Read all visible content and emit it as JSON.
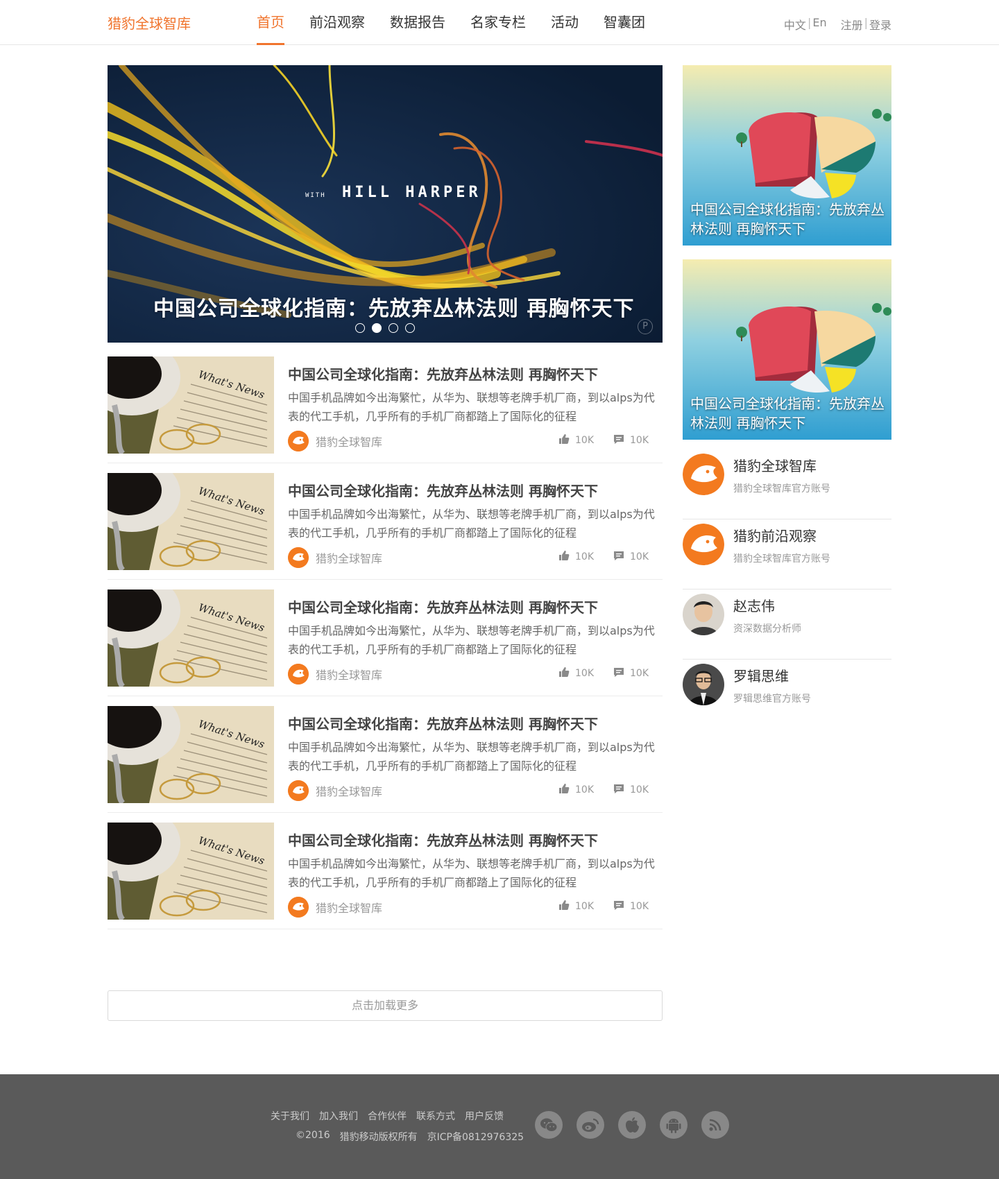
{
  "header": {
    "logo": "猎豹全球智库",
    "nav": [
      "首页",
      "前沿观察",
      "数据报告",
      "名家专栏",
      "活动",
      "智囊团"
    ],
    "active_nav": 0,
    "lang_zh": "中文",
    "lang_sep": "|",
    "lang_en": "En",
    "register": "注册",
    "auth_sep": "|",
    "login": "登录"
  },
  "hero": {
    "title": "中国公司全球化指南：先放弃丛林法则 再胸怀天下",
    "image_text": "HILL HARPER",
    "image_text_small": "WITH",
    "dots": 4,
    "active_dot": 1,
    "watermark": "P"
  },
  "articles": [
    {
      "title": "中国公司全球化指南：先放弃丛林法则 再胸怀天下",
      "desc": "中国手机品牌如今出海繁忙，从华为、联想等老牌手机厂商，到以alps为代表的代工手机，几乎所有的手机厂商都踏上了国际化的征程",
      "source": "猎豹全球智库",
      "likes": "10K",
      "comments": "10K"
    },
    {
      "title": "中国公司全球化指南：先放弃丛林法则 再胸怀天下",
      "desc": "中国手机品牌如今出海繁忙，从华为、联想等老牌手机厂商，到以alps为代表的代工手机，几乎所有的手机厂商都踏上了国际化的征程",
      "source": "猎豹全球智库",
      "likes": "10K",
      "comments": "10K"
    },
    {
      "title": "中国公司全球化指南：先放弃丛林法则 再胸怀天下",
      "desc": "中国手机品牌如今出海繁忙，从华为、联想等老牌手机厂商，到以alps为代表的代工手机，几乎所有的手机厂商都踏上了国际化的征程",
      "source": "猎豹全球智库",
      "likes": "10K",
      "comments": "10K"
    },
    {
      "title": "中国公司全球化指南：先放弃丛林法则 再胸怀天下",
      "desc": "中国手机品牌如今出海繁忙，从华为、联想等老牌手机厂商，到以alps为代表的代工手机，几乎所有的手机厂商都踏上了国际化的征程",
      "source": "猎豹全球智库",
      "likes": "10K",
      "comments": "10K"
    },
    {
      "title": "中国公司全球化指南：先放弃丛林法则 再胸怀天下",
      "desc": "中国手机品牌如今出海繁忙，从华为、联想等老牌手机厂商，到以alps为代表的代工手机，几乎所有的手机厂商都踏上了国际化的征程",
      "source": "猎豹全球智库",
      "likes": "10K",
      "comments": "10K"
    }
  ],
  "thumb_text": "What's News",
  "load_more": "点击加载更多",
  "side_cards": [
    {
      "caption": "中国公司全球化指南：先放弃丛林法则 再胸怀天下"
    },
    {
      "caption": "中国公司全球化指南：先放弃丛林法则 再胸怀天下"
    }
  ],
  "authors": [
    {
      "name": "猎豹全球智库",
      "desc": "猎豹全球智库官方账号",
      "avatar": "cheetah-logo"
    },
    {
      "name": "猎豹前沿观察",
      "desc": "猎豹全球智库官方账号",
      "avatar": "cheetah-logo"
    },
    {
      "name": "赵志伟",
      "desc": "资深数据分析师",
      "avatar": "person-photo"
    },
    {
      "name": "罗辑思维",
      "desc": "罗辑思维官方账号",
      "avatar": "person-photo"
    }
  ],
  "footer": {
    "links": [
      "关于我们",
      "加入我们",
      "合作伙伴",
      "联系方式",
      "用户反馈"
    ],
    "copyright": "©2016",
    "company": "猎豹移动版权所有",
    "icp": "京ICP备0812976325",
    "social": [
      "wechat-icon",
      "weibo-icon",
      "apple-icon",
      "android-icon",
      "rss-icon"
    ]
  },
  "colors": {
    "accent": "#f0742d",
    "footer_bg": "#5a5a5a"
  }
}
